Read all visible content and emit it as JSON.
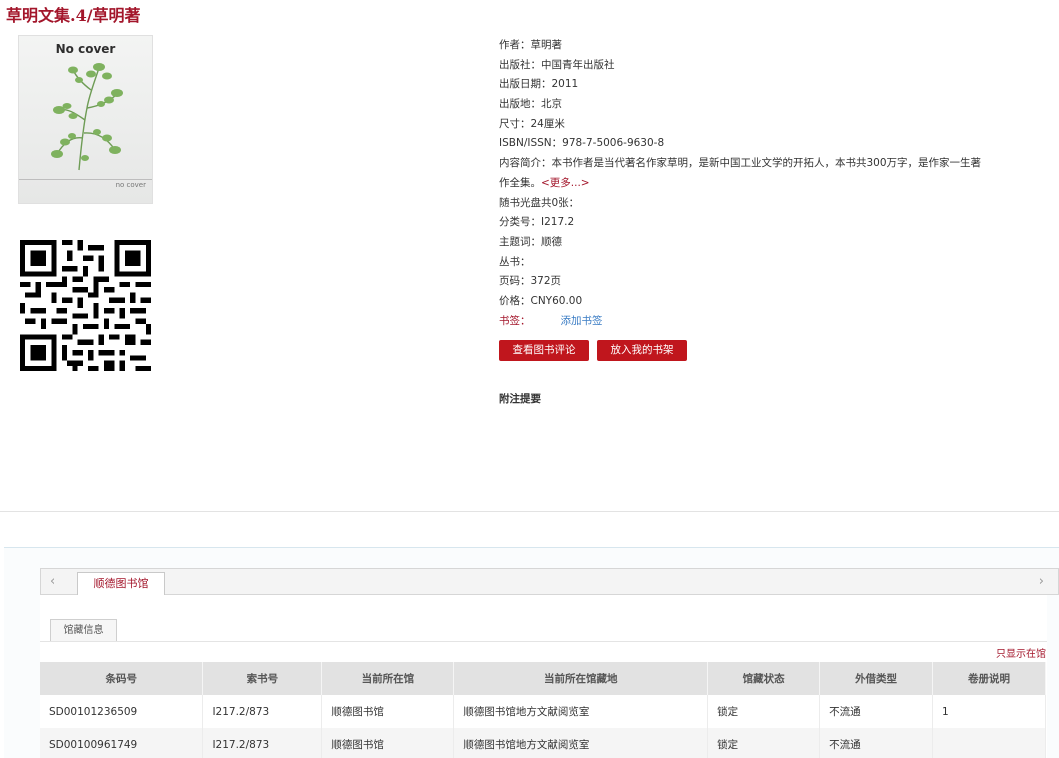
{
  "book": {
    "title": "草明文集.4/草明著",
    "cover": {
      "top_text": "No cover",
      "bottom_text": "no cover"
    },
    "meta": {
      "author": "作者：草明著",
      "publisher": "出版社：中国青年出版社",
      "pub_date": "出版日期：2011",
      "pub_place": "出版地：北京",
      "size": "尺寸：24厘米",
      "isbn": "ISBN/ISSN：978-7-5006-9630-8",
      "intro": "内容简介：本书作者是当代著名作家草明，是新中国工业文学的开拓人，本书共300万字，是作家一生著作全集。",
      "intro_more": "<更多...>",
      "disc": "随书光盘共0张：",
      "class_no": "分类号：I217.2",
      "subject": "主题词：顺德",
      "series": "丛书：",
      "pages": "页码：372页",
      "price": "价格：CNY60.00",
      "bookmark_label": "书签：",
      "bookmark_add": "添加书签"
    },
    "buttons": {
      "review": "查看图书评论",
      "shelf": "放入我的书架"
    },
    "notes_title": "附注提要"
  },
  "library_tabs": {
    "arrow_left": "‹",
    "arrow_right": "›",
    "active": "顺德图书馆"
  },
  "holdings": {
    "subtab": "馆藏信息",
    "only_available": "只显示在馆",
    "columns": [
      "条码号",
      "索书号",
      "当前所在馆",
      "当前所在馆藏地",
      "馆藏状态",
      "外借类型",
      "卷册说明"
    ],
    "rows": [
      [
        "SD00101236509",
        "I217.2/873",
        "顺德图书馆",
        "顺德图书馆地方文献阅览室",
        "锁定",
        "不流通",
        "1"
      ],
      [
        "SD00100961749",
        "I217.2/873",
        "顺德图书馆",
        "顺德图书馆地方文献阅览室",
        "锁定",
        "不流通",
        ""
      ]
    ]
  },
  "colors": {
    "accent": "#a3162b",
    "button": "#c0161d",
    "link": "#3a7cc4"
  },
  "icons": [
    "plant-illustration",
    "qr-code",
    "chevron-left-icon",
    "chevron-right-icon"
  ]
}
